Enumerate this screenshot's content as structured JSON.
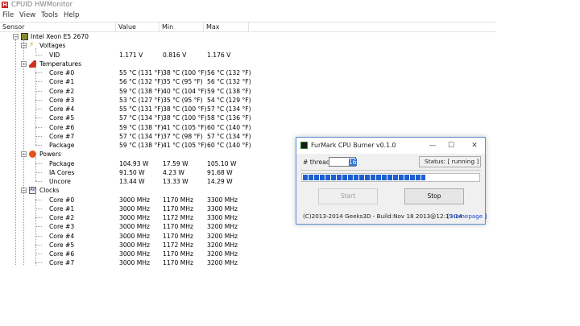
{
  "app": {
    "title": "CPUID HWMonitor",
    "icon": "hwmonitor-logo-icon"
  },
  "menu": [
    "File",
    "View",
    "Tools",
    "Help"
  ],
  "columns": {
    "sensor": "Sensor",
    "value": "Value",
    "min": "Min",
    "max": "Max"
  },
  "tree": {
    "cpu": "Intel Xeon E5 2670",
    "voltages": "Voltages",
    "vid": {
      "label": "VID",
      "value": "1.171 V",
      "min": "0.816 V",
      "max": "1.176 V"
    },
    "temperatures": "Temperatures",
    "temps": [
      {
        "label": "Core #0",
        "value": "55 °C  (131 °F)",
        "min": "38 °C  (100 °F)",
        "max": "56 °C  (132 °F)"
      },
      {
        "label": "Core #1",
        "value": "56 °C  (132 °F)",
        "min": "35 °C  (95 °F)",
        "max": "56 °C  (132 °F)"
      },
      {
        "label": "Core #2",
        "value": "59 °C  (138 °F)",
        "min": "40 °C  (104 °F)",
        "max": "59 °C  (138 °F)"
      },
      {
        "label": "Core #3",
        "value": "53 °C  (127 °F)",
        "min": "35 °C  (95 °F)",
        "max": "54 °C  (129 °F)"
      },
      {
        "label": "Core #4",
        "value": "55 °C  (131 °F)",
        "min": "38 °C  (100 °F)",
        "max": "57 °C  (134 °F)"
      },
      {
        "label": "Core #5",
        "value": "57 °C  (134 °F)",
        "min": "38 °C  (100 °F)",
        "max": "58 °C  (136 °F)"
      },
      {
        "label": "Core #6",
        "value": "59 °C  (138 °F)",
        "min": "41 °C  (105 °F)",
        "max": "60 °C  (140 °F)"
      },
      {
        "label": "Core #7",
        "value": "57 °C  (134 °F)",
        "min": "37 °C  (98 °F)",
        "max": "57 °C  (134 °F)"
      },
      {
        "label": "Package",
        "value": "59 °C  (138 °F)",
        "min": "41 °C  (105 °F)",
        "max": "60 °C  (140 °F)"
      }
    ],
    "powers": "Powers",
    "power_rows": [
      {
        "label": "Package",
        "value": "104.93 W",
        "min": "17.59 W",
        "max": "105.10 W"
      },
      {
        "label": "IA Cores",
        "value": "91.50 W",
        "min": "4.23 W",
        "max": "91.68 W"
      },
      {
        "label": "Uncore",
        "value": "13.44 W",
        "min": "13.33 W",
        "max": "14.29 W"
      }
    ],
    "clocks": "Clocks",
    "clock_rows": [
      {
        "label": "Core #0",
        "value": "3000 MHz",
        "min": "1170 MHz",
        "max": "3300 MHz"
      },
      {
        "label": "Core #1",
        "value": "3000 MHz",
        "min": "1170 MHz",
        "max": "3300 MHz"
      },
      {
        "label": "Core #2",
        "value": "3000 MHz",
        "min": "1172 MHz",
        "max": "3300 MHz"
      },
      {
        "label": "Core #3",
        "value": "3000 MHz",
        "min": "1170 MHz",
        "max": "3200 MHz"
      },
      {
        "label": "Core #4",
        "value": "3000 MHz",
        "min": "1170 MHz",
        "max": "3200 MHz"
      },
      {
        "label": "Core #5",
        "value": "3000 MHz",
        "min": "1172 MHz",
        "max": "3200 MHz"
      },
      {
        "label": "Core #6",
        "value": "3000 MHz",
        "min": "1170 MHz",
        "max": "3200 MHz"
      },
      {
        "label": "Core #7",
        "value": "3000 MHz",
        "min": "1170 MHz",
        "max": "3200 MHz"
      }
    ]
  },
  "dialog": {
    "title": "FurMark CPU Burner v0.1.0",
    "minimize": "—",
    "maximize": "☐",
    "close": "✕",
    "threads_label": "# threads",
    "threads_value": "16",
    "status": "Status: [ running ]",
    "progress_fraction": 0.7,
    "start_label": "Start",
    "stop_label": "Stop",
    "footer": "(C)2013-2014 Geeks3D - Build:Nov 18 2013@12:19:14",
    "homepage": "[ Homepage ]"
  },
  "colors": {
    "accent": "#1e5fd1",
    "window_border": "#5b8fd6",
    "link": "#1a47d1"
  }
}
